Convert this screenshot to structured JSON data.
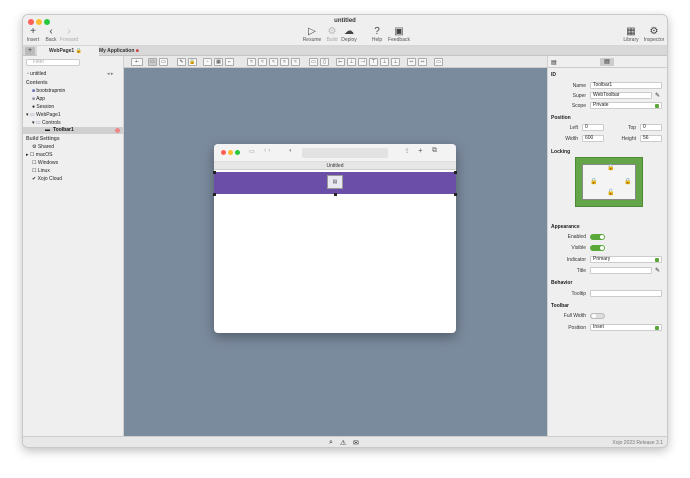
{
  "window": {
    "title": "untitled"
  },
  "toolbar": {
    "insert": "Insert",
    "back": "Back",
    "forward": "Forward",
    "resume": "Resume",
    "build": "Build",
    "deploy": "Deploy",
    "help": "Help",
    "feedback": "Feedback",
    "library": "Library",
    "inspector": "Inspector"
  },
  "tabs": {
    "webpage1": "WebPage1",
    "my_application": "My Application"
  },
  "navigator": {
    "filter_placeholder": "Filter",
    "project": "untitled",
    "contents_header": "Contents",
    "items": [
      "bootstrapmin",
      "App",
      "Session",
      "WebPage1",
      "Controls",
      "Toolbar1"
    ],
    "build_header": "Build Settings",
    "build_items": [
      "Shared",
      "macOS",
      "Windows",
      "Linux",
      "Xojo Cloud"
    ]
  },
  "preview": {
    "tab_title": "Untitled"
  },
  "inspector": {
    "id_header": "ID",
    "name_label": "Name",
    "name_value": "Toolbar1",
    "super_label": "Super",
    "super_value": "WebToolbar",
    "scope_label": "Scope",
    "scope_value": "Private",
    "position_header": "Position",
    "left_label": "Left",
    "left_value": "0",
    "top_label": "Top",
    "top_value": "0",
    "width_label": "Width",
    "width_value": "600",
    "height_label": "Height",
    "height_value": "56",
    "locking_header": "Locking",
    "appearance_header": "Appearance",
    "enabled_label": "Enabled",
    "visible_label": "Visible",
    "indicator_label": "Indicator",
    "indicator_value": "Primary",
    "title_label": "Title",
    "behavior_header": "Behavior",
    "tooltip_label": "Tooltip",
    "toolbar_header": "Toolbar",
    "fullwidth_label": "Full Width",
    "position_label": "Position",
    "position_value": "Inset"
  },
  "status": {
    "version": "Xojo 2023 Release 3.1"
  },
  "colors": {
    "canvas": "#7b8b9e",
    "toolbar_purple": "#6b4ea8",
    "lock_green": "#63a548"
  }
}
